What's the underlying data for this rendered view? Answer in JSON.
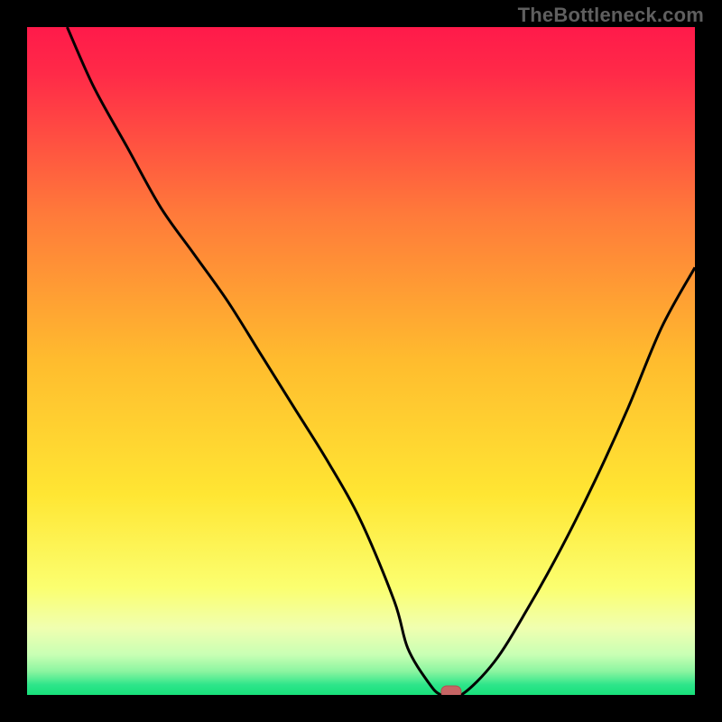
{
  "watermark": "TheBottleneck.com",
  "colors": {
    "frame": "#000000",
    "gradient_top": "#ff1a4a",
    "gradient_mid_orange": "#ff9a2a",
    "gradient_yellow": "#ffe633",
    "gradient_pale": "#f7ffbf",
    "gradient_green": "#18e07a",
    "curve": "#000000",
    "marker_fill": "#c66464",
    "marker_stroke": "#b25050"
  },
  "chart_data": {
    "type": "line",
    "title": "",
    "xlabel": "",
    "ylabel": "",
    "xlim": [
      0,
      100
    ],
    "ylim": [
      0,
      100
    ],
    "series": [
      {
        "name": "bottleneck-curve",
        "x": [
          6,
          10,
          15,
          20,
          25,
          30,
          35,
          40,
          45,
          50,
          55,
          57,
          60,
          62,
          65,
          70,
          75,
          80,
          85,
          90,
          95,
          100
        ],
        "y": [
          100,
          91,
          82,
          73,
          66,
          59,
          51,
          43,
          35,
          26,
          14,
          7,
          2,
          0,
          0,
          5,
          13,
          22,
          32,
          43,
          55,
          64
        ]
      }
    ],
    "marker": {
      "x": 63.5,
      "y": 0
    },
    "gradient_stops": [
      {
        "offset": 0,
        "color": "#ff1a4a"
      },
      {
        "offset": 0.07,
        "color": "#ff2a48"
      },
      {
        "offset": 0.28,
        "color": "#ff7a3a"
      },
      {
        "offset": 0.5,
        "color": "#ffbc2e"
      },
      {
        "offset": 0.7,
        "color": "#ffe633"
      },
      {
        "offset": 0.84,
        "color": "#fbff70"
      },
      {
        "offset": 0.9,
        "color": "#f0ffb0"
      },
      {
        "offset": 0.94,
        "color": "#c8ffb4"
      },
      {
        "offset": 0.965,
        "color": "#8af5a0"
      },
      {
        "offset": 0.985,
        "color": "#2de58a"
      },
      {
        "offset": 1.0,
        "color": "#18e07a"
      }
    ]
  }
}
